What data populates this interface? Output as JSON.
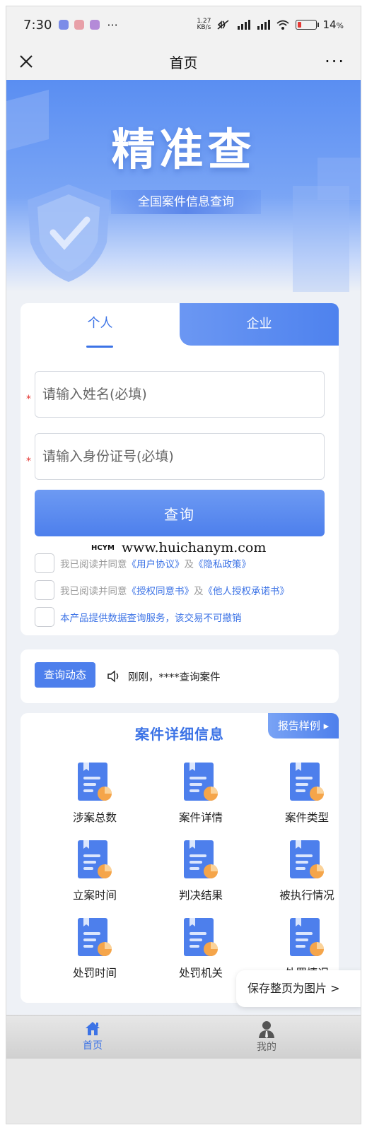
{
  "status_bar": {
    "time": "7:30",
    "more": "···",
    "speed_top": "1.27",
    "speed_bottom": "KB/s",
    "battery": "14",
    "battery_unit": "%",
    "battery_level": 0.14
  },
  "nav": {
    "title": "首页",
    "more": "···"
  },
  "hero": {
    "title": "精准查",
    "subtitle": "全国案件信息查询"
  },
  "form": {
    "tabs": [
      {
        "label": "个人"
      },
      {
        "label": "企业"
      }
    ],
    "name_placeholder": "请输入姓名(必填)",
    "id_placeholder": "请输入身份证号(必填)",
    "required_mark": "*",
    "query_button": "查询",
    "agreements": [
      {
        "prefix": "我已阅读并同意",
        "link1": "《用户协议》",
        "mid": "及",
        "link2": "《隐私政策》"
      },
      {
        "prefix": "我已阅读并同意",
        "link1": "《授权同意书》",
        "mid": "及",
        "link2": "《他人授权承诺书》"
      }
    ],
    "notice": "本产品提供数据查询服务，该交易不可撤销",
    "watermark_logo": "HCYM",
    "watermark_url": "www.huichanym.com"
  },
  "dynamic": {
    "badge": "查询动态",
    "text": "刚刚，****查询案件"
  },
  "details": {
    "title": "案件详细信息",
    "sample_button": "报告样例",
    "items": [
      {
        "label": "涉案总数"
      },
      {
        "label": "案件详情"
      },
      {
        "label": "案件类型"
      },
      {
        "label": "立案时间"
      },
      {
        "label": "判决结果"
      },
      {
        "label": "被执行情况"
      },
      {
        "label": "处罚时间"
      },
      {
        "label": "处罚机关"
      },
      {
        "label": "处罚情况"
      }
    ]
  },
  "save_page": "保存整页为图片 >",
  "tabbar": {
    "home": "首页",
    "mine": "我的"
  },
  "colors": {
    "accent": "#3c73e6",
    "button": "#4d7fec",
    "required": "#e53935"
  }
}
